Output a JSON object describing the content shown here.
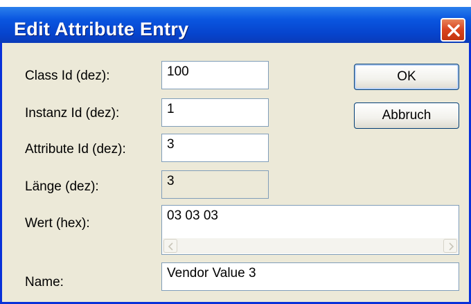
{
  "window": {
    "title": "Edit Attribute Entry"
  },
  "icons": {
    "close": "close-icon",
    "scroll_left": "chevron-left-icon",
    "scroll_right": "chevron-right-icon"
  },
  "colors": {
    "titlebar": "#0a56e0",
    "close_button": "#d9431e",
    "dialog_background": "#ece9d8"
  },
  "form": {
    "class_id": {
      "label": "Class Id (dez):",
      "value": "100"
    },
    "instance_id": {
      "label": "Instanz Id (dez):",
      "value": "1"
    },
    "attribute_id": {
      "label": "Attribute Id (dez):",
      "value": "3"
    },
    "length": {
      "label": "Länge (dez):",
      "value": "3"
    },
    "value_hex": {
      "label": "Wert (hex):",
      "value": "03 03 03"
    },
    "name": {
      "label": "Name:",
      "value": "Vendor Value 3"
    }
  },
  "buttons": {
    "ok": "OK",
    "cancel": "Abbruch"
  }
}
